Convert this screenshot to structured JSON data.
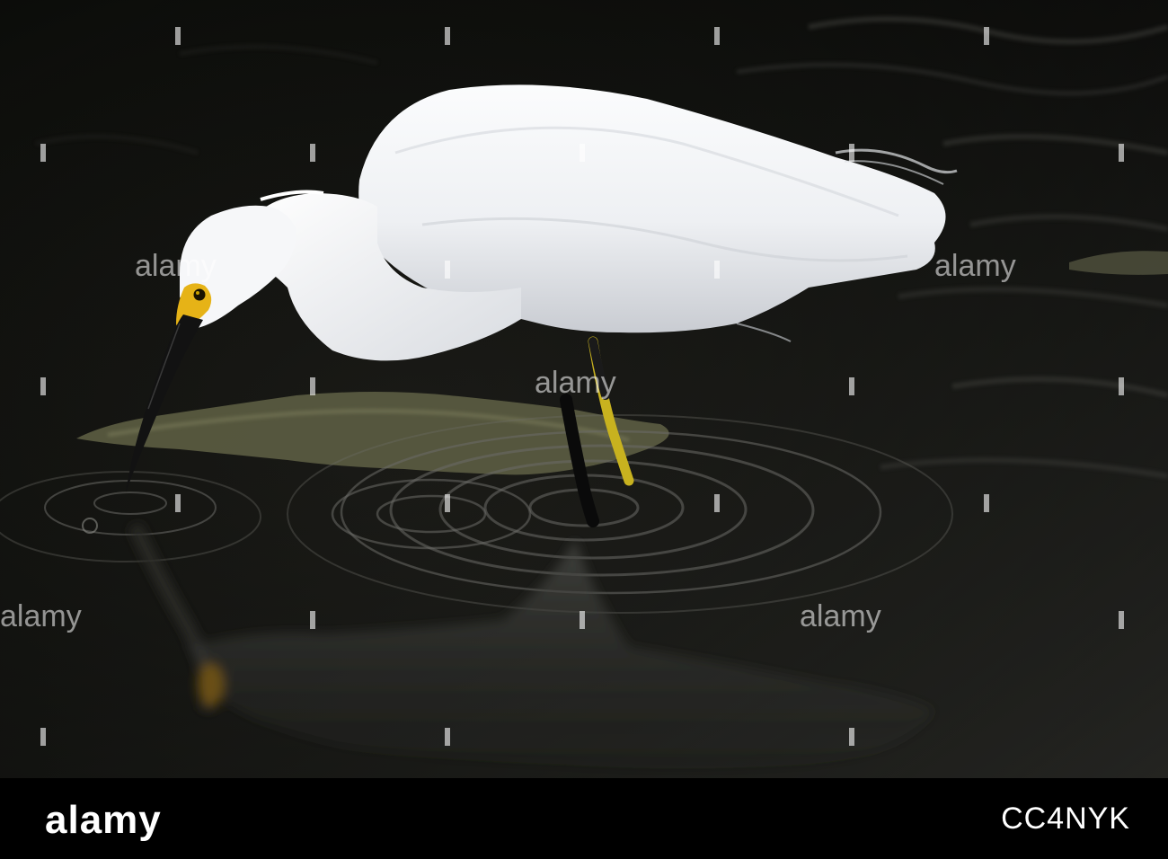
{
  "image": {
    "subject": "snowy-egret-wading",
    "colors": {
      "water": "#0d0e0b",
      "bird": "#f4f5f7",
      "beak": "#111111",
      "lore": "#e6b317",
      "legs": "#0a0a0a",
      "feet": "#d8c12c",
      "algae": "#6a6b4c"
    }
  },
  "watermark": {
    "text": "alamy"
  },
  "footer": {
    "logo": "alamy",
    "image_code": "CC4NYK"
  }
}
